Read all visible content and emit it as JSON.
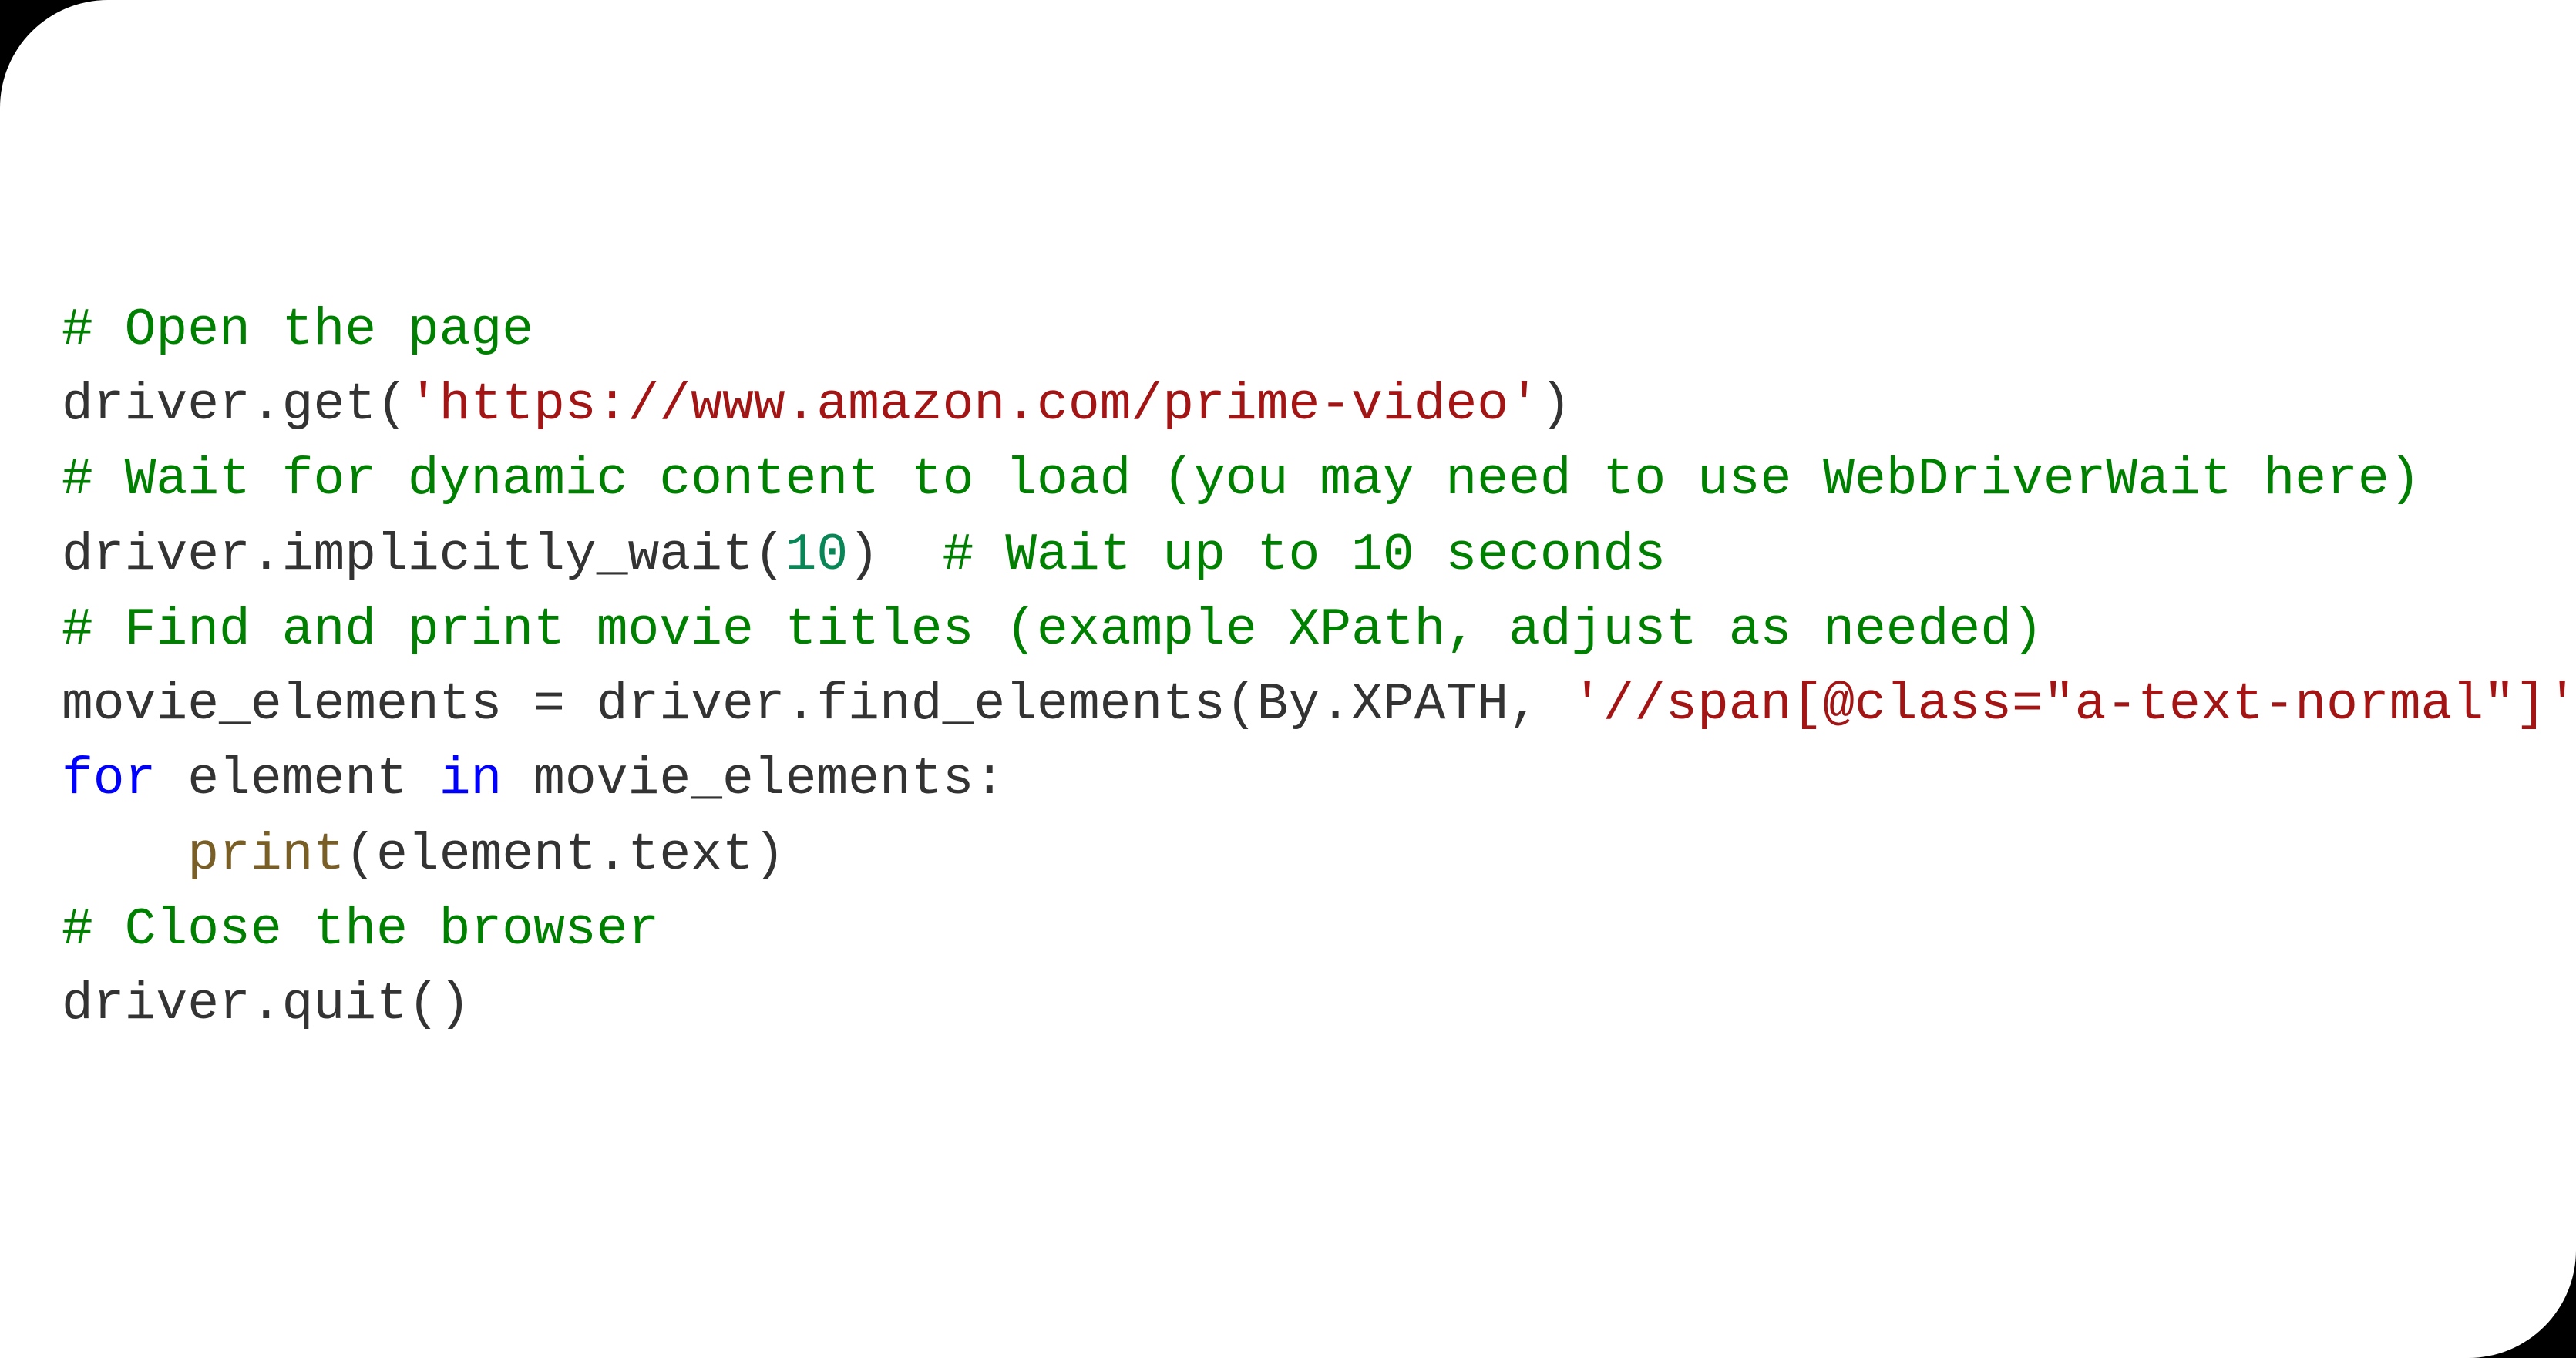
{
  "code": {
    "lines": [
      [
        {
          "cls": "tok-comment",
          "text": "# Open the page"
        }
      ],
      [
        {
          "cls": "tok-default",
          "text": "driver.get("
        },
        {
          "cls": "tok-string",
          "text": "'https://www.amazon.com/prime-video'"
        },
        {
          "cls": "tok-default",
          "text": ")"
        }
      ],
      [
        {
          "cls": "tok-comment",
          "text": "# Wait for dynamic content to load (you may need to use WebDriverWait here)"
        }
      ],
      [
        {
          "cls": "tok-default",
          "text": "driver.implicitly_wait("
        },
        {
          "cls": "tok-number",
          "text": "10"
        },
        {
          "cls": "tok-default",
          "text": ")  "
        },
        {
          "cls": "tok-comment",
          "text": "# Wait up to 10 seconds"
        }
      ],
      [
        {
          "cls": "tok-comment",
          "text": "# Find and print movie titles (example XPath, adjust as needed)"
        }
      ],
      [
        {
          "cls": "tok-default",
          "text": "movie_elements = driver.find_elements(By.XPATH, "
        },
        {
          "cls": "tok-string",
          "text": "'//span[@class=\"a-text-normal\"]'"
        },
        {
          "cls": "tok-default",
          "text": ")"
        }
      ],
      [
        {
          "cls": "tok-keyword",
          "text": "for"
        },
        {
          "cls": "tok-default",
          "text": " element "
        },
        {
          "cls": "tok-keyword",
          "text": "in"
        },
        {
          "cls": "tok-default",
          "text": " movie_elements:"
        }
      ],
      [
        {
          "cls": "tok-default",
          "text": "    "
        },
        {
          "cls": "tok-builtin",
          "text": "print"
        },
        {
          "cls": "tok-default",
          "text": "(element.text)"
        }
      ],
      [
        {
          "cls": "tok-comment",
          "text": "# Close the browser"
        }
      ],
      [
        {
          "cls": "tok-default",
          "text": "driver.quit()"
        }
      ]
    ]
  }
}
